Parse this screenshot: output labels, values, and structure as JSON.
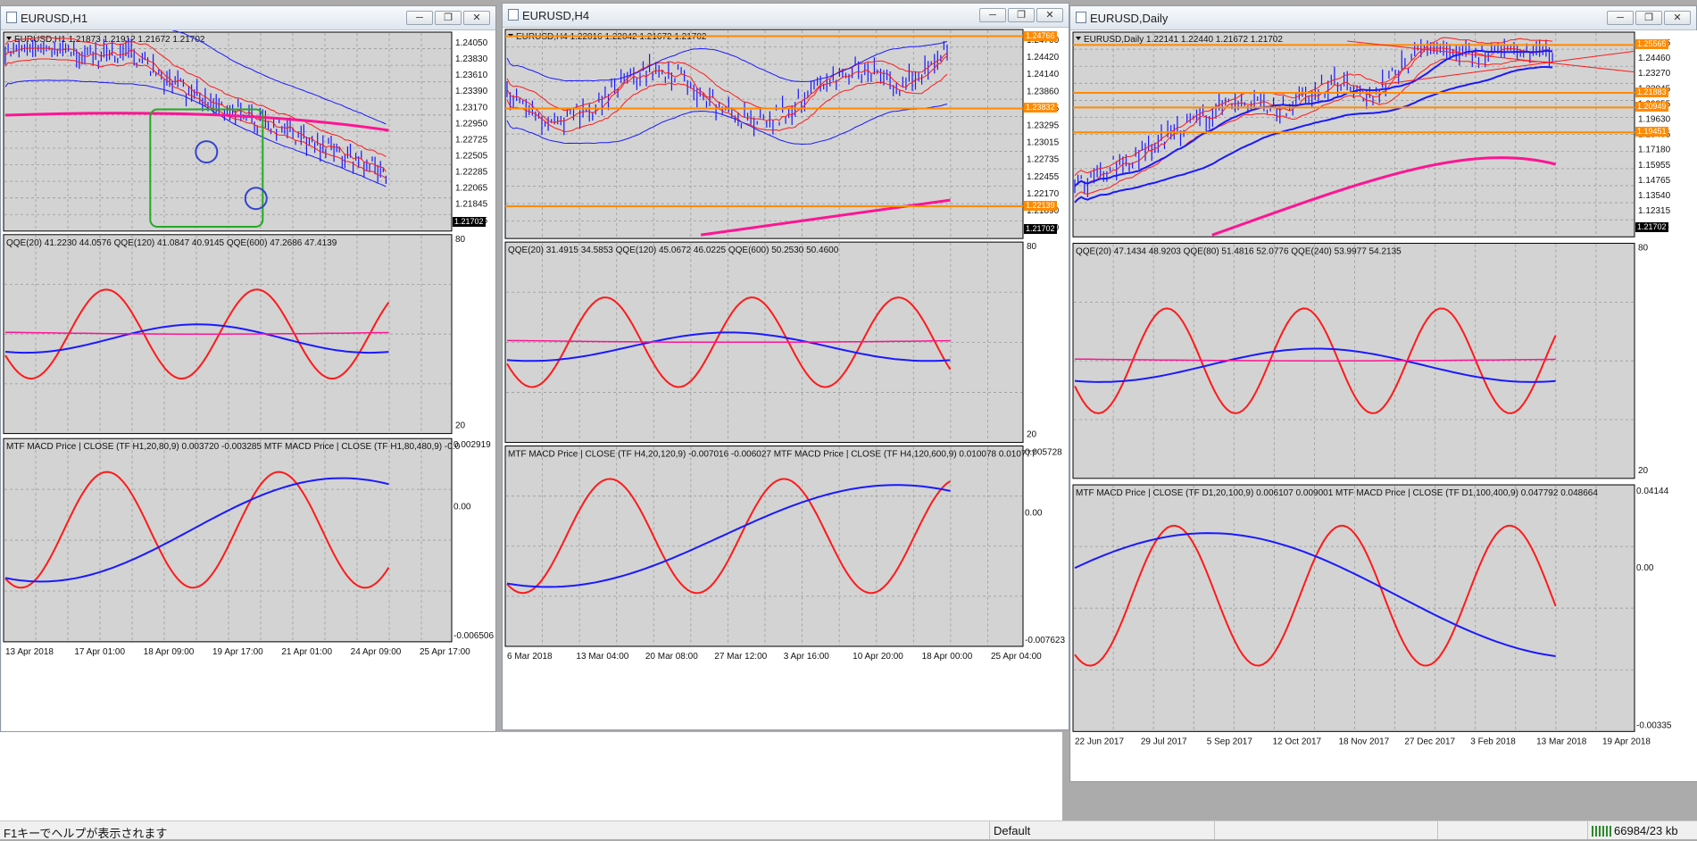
{
  "windows": [
    {
      "title": "EURUSD,H1",
      "header": "EURUSD,H1  1.21873 1.21912 1.21672 1.21702",
      "price_axis": [
        "1.24050",
        "1.23830",
        "1.23610",
        "1.23390",
        "1.23170",
        "1.22950",
        "1.22725",
        "1.22505",
        "1.22285",
        "1.22065",
        "1.21845",
        "1.21625"
      ],
      "current_price": "1.21702",
      "qqe_header": "QQE(20) 41.2230 44.0576  QQE(120) 41.0847 40.9145  QQE(600) 47.2686 47.4139",
      "qqe_levels": [
        "80",
        "20"
      ],
      "macd_header": "MTF MACD Price | CLOSE  (TF H1,20,80,9) 0.003720 -0.003285  MTF MACD Price | CLOSE  (TF H1,80,480,9) -0.0",
      "macd_levels": [
        "0.002919",
        "0.00",
        "-0.006506"
      ],
      "time_axis": [
        "13 Apr 2018",
        "17 Apr 01:00",
        "18 Apr 09:00",
        "19 Apr 17:00",
        "21 Apr 01:00",
        "24 Apr 09:00",
        "25 Apr 17:00"
      ],
      "orange_levels": []
    },
    {
      "title": "EURUSD,H4",
      "header": "EURUSD,H4  1.22016 1.22042 1.21672 1.21702",
      "price_axis": [
        "1.24700",
        "1.24420",
        "1.24140",
        "1.23860",
        "1.23575",
        "1.23295",
        "1.23015",
        "1.22735",
        "1.22455",
        "1.22170",
        "1.21890",
        "1.21610"
      ],
      "current_price": "1.21702",
      "qqe_header": "QQE(20) 31.4915 34.5853  QQE(120) 45.0672 46.0225  QQE(600) 50.2530 50.4600",
      "qqe_levels": [
        "80",
        "20"
      ],
      "macd_header": "MTF MACD Price | CLOSE  (TF H4,20,120,9) -0.007016 -0.006027  MTF MACD Price | CLOSE  (TF H4,120,600,9) 0.010078 0.010777",
      "macd_levels": [
        "0.005728",
        "0.00",
        "-0.007623"
      ],
      "time_axis": [
        "6 Mar 2018",
        "13 Mar 04:00",
        "20 Mar 08:00",
        "27 Mar 12:00",
        "3 Apr 16:00",
        "10 Apr 20:00",
        "18 Apr 00:00",
        "25 Apr 04:00"
      ],
      "orange_levels": [
        "1.24766",
        "1.23832",
        "1.22139"
      ]
    },
    {
      "title": "EURUSD,Daily",
      "header": "EURUSD,Daily  1.22141 1.22440 1.21672 1.21702",
      "price_axis": [
        "1.25685",
        "1.24460",
        "1.23270",
        "1.22045",
        "1.20855",
        "1.19630",
        "1.18405",
        "1.17180",
        "1.15955",
        "1.14765",
        "1.13540",
        "1.12315",
        "1.11125"
      ],
      "current_price": "1.21702",
      "qqe_header": "QQE(20) 47.1434 48.9203  QQE(80) 51.4816 52.0776  QQE(240) 53.9977 54.2135",
      "qqe_levels": [
        "80",
        "20"
      ],
      "macd_header": "MTF MACD Price | CLOSE  (TF D1,20,100,9) 0.006107 0.009001  MTF MACD Price | CLOSE  (TF D1,100,400,9) 0.047792 0.048664",
      "macd_levels": [
        "0.04144",
        "0.00",
        "-0.00335"
      ],
      "time_axis": [
        "22 Jun 2017",
        "29 Jul 2017",
        "5 Sep 2017",
        "12 Oct 2017",
        "18 Nov 2017",
        "27 Dec 2017",
        "3 Feb 2018",
        "13 Mar 2018",
        "19 Apr 2018"
      ],
      "orange_levels": [
        "1.25565",
        "1.21883",
        "1.20949",
        "1.19451"
      ]
    }
  ],
  "window_buttons": {
    "minimize": "─",
    "restore": "❐",
    "close": "✕"
  },
  "status_bar": {
    "help": "F1キーでヘルプが表示されます",
    "profile": "Default",
    "traffic": "66984/23 kb"
  },
  "colors": {
    "background": "#d3d3d3",
    "grid": "#9a9a9a",
    "red": "#ff1a1a",
    "blue": "#1a1aff",
    "magenta": "#ff1493",
    "orange": "#ff8a00",
    "green": "#22aa22"
  }
}
